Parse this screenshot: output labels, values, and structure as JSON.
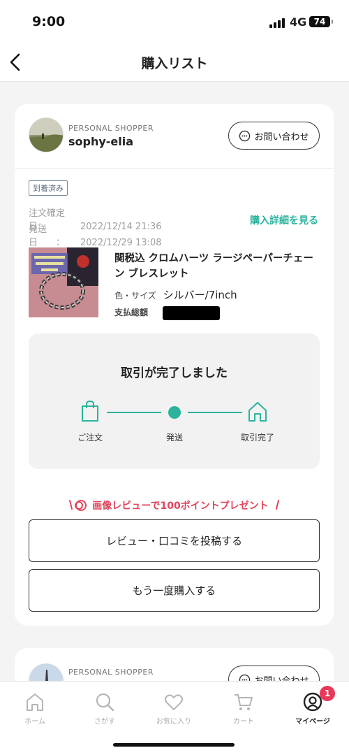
{
  "status_bar": {
    "time": "9:00",
    "network": "4G",
    "battery": "74"
  },
  "nav": {
    "title": "購入リスト"
  },
  "order": {
    "shop_type": "PERSONAL SHOPPER",
    "shop_name": "sophy-elia",
    "contact_label": "お問い合わせ",
    "status_badge": "到着済み",
    "order_date_label": "注文確定日：",
    "order_date": "2022/12/14 21:36",
    "ship_date_label": "発送日　　：",
    "ship_date": "2022/12/29 13:08",
    "detail_link": "購入詳細を見る",
    "product_name": "関税込 クロムハーツ ラージペーパーチェーン ブレスレット",
    "spec_label": "色・サイズ",
    "spec_value": "シルバー/7inch",
    "total_label": "支払総額",
    "progress_title": "取引が完了しました",
    "steps": [
      {
        "label": "ご注文"
      },
      {
        "label": "発送"
      },
      {
        "label": "取引完了"
      }
    ],
    "promo": "画像レビューで100ポイントプレゼント",
    "review_button": "レビュー・口コミを投稿する",
    "rebuy_button": "もう一度購入する"
  },
  "order2": {
    "shop_type": "PERSONAL SHOPPER",
    "contact_label": "お問い合わせ"
  },
  "tabs": [
    {
      "label": "ホーム",
      "icon": "home-icon"
    },
    {
      "label": "さがす",
      "icon": "search-icon"
    },
    {
      "label": "お気に入り",
      "icon": "heart-icon"
    },
    {
      "label": "カート",
      "icon": "cart-icon"
    },
    {
      "label": "マイページ",
      "icon": "mypage-icon",
      "badge": "1"
    }
  ],
  "colors": {
    "accent": "#2bb39d",
    "promo": "#e2455c",
    "badge": "#e8395a"
  }
}
